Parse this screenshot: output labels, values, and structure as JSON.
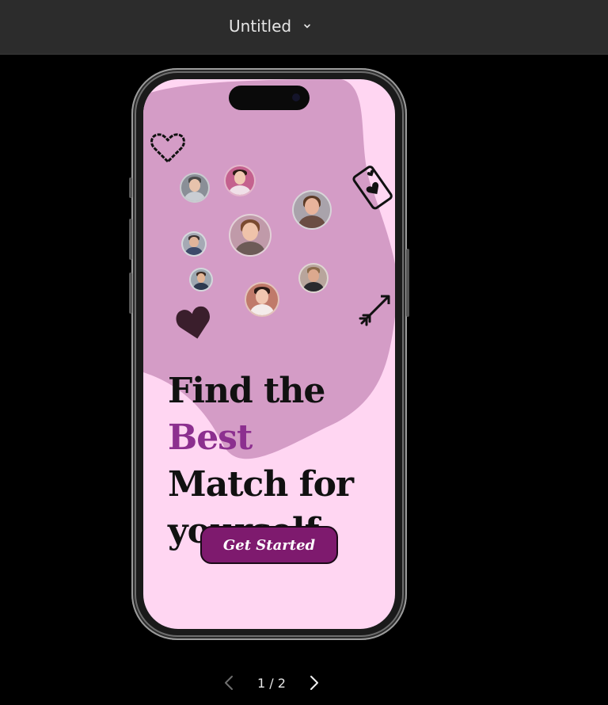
{
  "header": {
    "title": "Untitled",
    "title_menu_icon": "chevron-down-icon"
  },
  "screen": {
    "headline": {
      "line1_prefix": "Find the",
      "line1_accent": "Best",
      "line2": "Match for",
      "line3": "yourself"
    },
    "cta_label": "Get Started",
    "decorations": [
      "heart-outline-icon",
      "phone-hearts-icon",
      "arrow-icon",
      "heart-filled-icon"
    ],
    "avatars": [
      "avatar-man-gray",
      "avatar-woman-smiling",
      "avatar-woman-curly",
      "avatar-woman-main",
      "avatar-man-small",
      "avatar-man-suit",
      "avatar-man-beard",
      "avatar-woman-pink"
    ]
  },
  "pager": {
    "label": "1 / 2",
    "prev_icon": "chevron-left-icon",
    "next_icon": "chevron-right-icon"
  },
  "colors": {
    "screen_bg": "#ffd6f2",
    "blob": "#d49cc6",
    "accent_text": "#8c2f8f",
    "cta_bg": "#7e1a6e"
  }
}
